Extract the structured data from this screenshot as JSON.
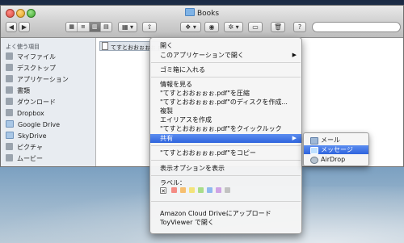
{
  "window": {
    "title": "Books",
    "search_placeholder": ""
  },
  "toolbar": {
    "nav_back": "◀",
    "nav_forward": "▶",
    "view_buttons": [
      "▦",
      "≡",
      "▥",
      "▤"
    ],
    "arrange": "▦ ▾",
    "share": "⇧",
    "dropbox": "❖ ▾",
    "quicklook": "◉",
    "action": "✲ ▾",
    "newfolder": "▭",
    "trash": "🗑",
    "help": "?"
  },
  "sidebar": {
    "header": "よく使う項目",
    "items": [
      {
        "label": "マイファイル",
        "icon": "all-files-icon"
      },
      {
        "label": "デスクトップ",
        "icon": "desktop-icon"
      },
      {
        "label": "アプリケーション",
        "icon": "applications-icon"
      },
      {
        "label": "書類",
        "icon": "documents-icon"
      },
      {
        "label": "ダウンロード",
        "icon": "downloads-icon"
      },
      {
        "label": "Dropbox",
        "icon": "dropbox-icon"
      },
      {
        "label": "Google Drive",
        "icon": "folder-icon"
      },
      {
        "label": "SkyDrive",
        "icon": "folder-icon"
      },
      {
        "label": "ピクチャ",
        "icon": "pictures-icon"
      },
      {
        "label": "ムービー",
        "icon": "movies-icon"
      }
    ]
  },
  "content": {
    "selected_file": "てすとおおぉぉぉ.pdf"
  },
  "context_menu": {
    "items": [
      {
        "label": "開く"
      },
      {
        "label": "このアプリケーションで開く",
        "submenu": true
      },
      {
        "label": "ゴミ箱に入れる"
      },
      {
        "label": "情報を見る"
      },
      {
        "label": "\"てすとおおぉぉぉ.pdf\"を圧縮"
      },
      {
        "label": "\"てすとおおぉぉぉ.pdf\"のディスクを作成..."
      },
      {
        "label": "複製"
      },
      {
        "label": "エイリアスを作成"
      },
      {
        "label": "\"てすとおおぉぉぉ.pdf\"をクイックルック"
      },
      {
        "label": "共有",
        "submenu": true,
        "highlighted": true
      },
      {
        "label": "\"てすとおおぉぉぉ.pdf\"をコピー"
      },
      {
        "label": "表示オプションを表示"
      },
      {
        "label": "ラベル："
      },
      {
        "label": "Amazon Cloud Driveにアップロード"
      },
      {
        "label": "ToyViewer で開く"
      }
    ],
    "label_colors": [
      "#f48b84",
      "#f6bf70",
      "#f3e37a",
      "#a8dd8a",
      "#8fb8ef",
      "#cfa3e4",
      "#c2c2c2"
    ],
    "label_none": "✕"
  },
  "share_submenu": {
    "items": [
      {
        "label": "メール",
        "icon": "mail-icon"
      },
      {
        "label": "メッセージ",
        "icon": "messages-icon",
        "highlighted": true
      },
      {
        "label": "AirDrop",
        "icon": "airdrop-icon"
      }
    ]
  },
  "colors": {
    "highlight": "#3a6fe2",
    "sidebar_bg": "#e8ecf1"
  }
}
